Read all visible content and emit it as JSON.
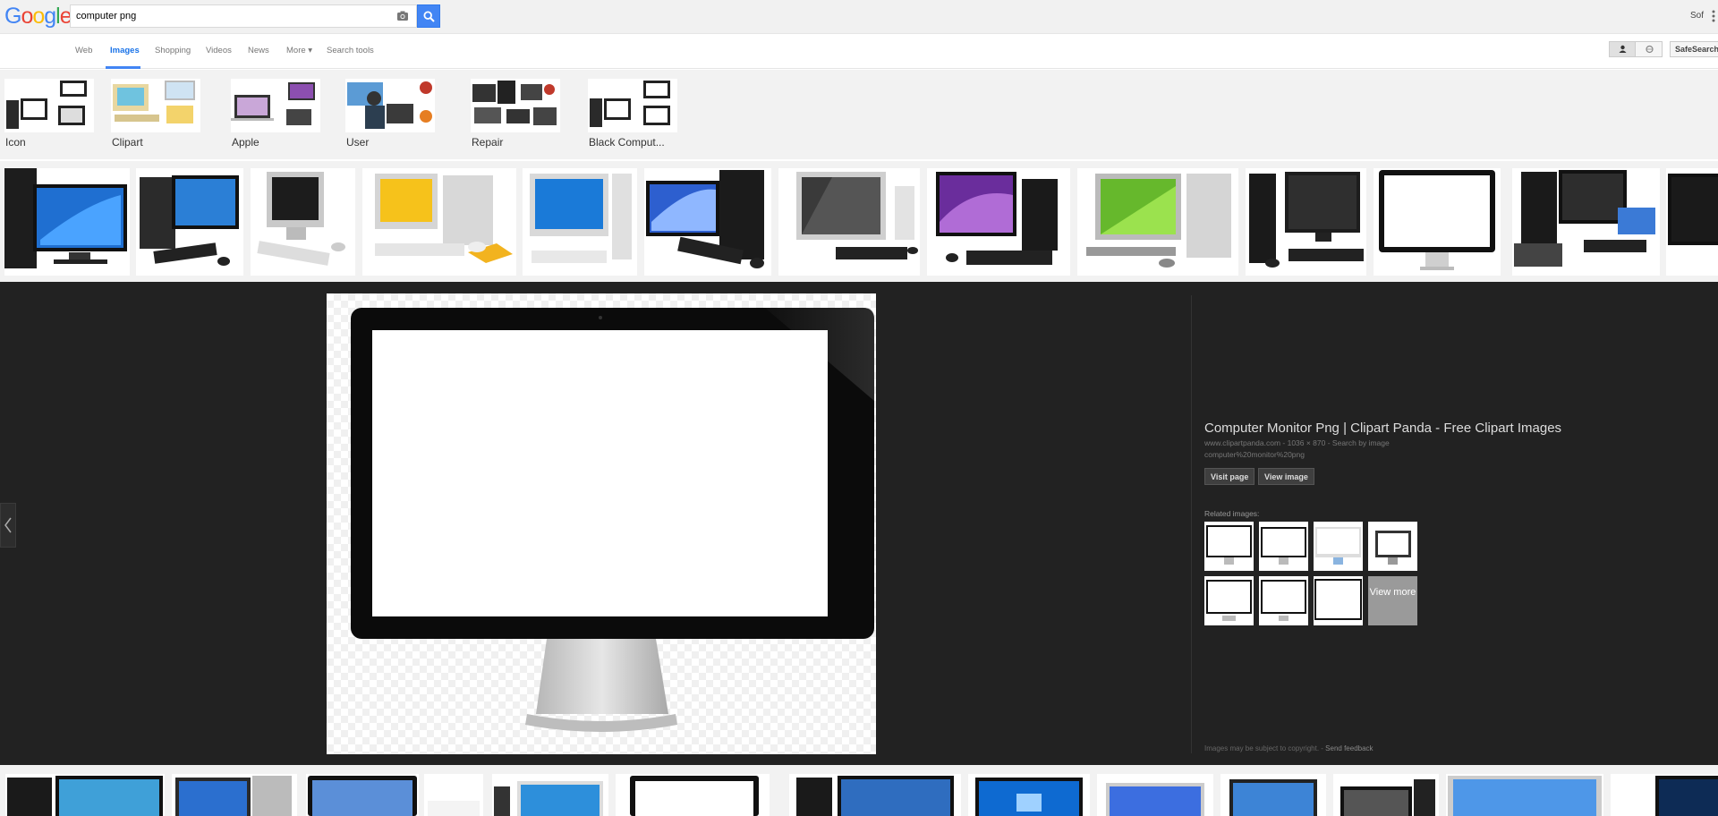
{
  "header": {
    "logo_letters": [
      {
        "ch": "G",
        "color": "#4285f4"
      },
      {
        "ch": "o",
        "color": "#ea4335"
      },
      {
        "ch": "o",
        "color": "#fbbc05"
      },
      {
        "ch": "g",
        "color": "#4285f4"
      },
      {
        "ch": "l",
        "color": "#34a853"
      },
      {
        "ch": "e",
        "color": "#ea4335"
      }
    ],
    "search_value": "computer png",
    "user_name": "Sof",
    "accent_color": "#4285f4"
  },
  "nav": {
    "tabs": [
      "Web",
      "Images",
      "Shopping",
      "Videos",
      "News",
      "More ▾",
      "Search tools"
    ],
    "active_tab": "Images",
    "safesearch_label": "SafeSearch"
  },
  "categories": [
    "Icon",
    "Clipart",
    "Apple",
    "User",
    "Repair",
    "Black Comput..."
  ],
  "preview": {
    "title": "Computer Monitor Png | Clipart Panda - Free Clipart Images",
    "meta": "www.clipartpanda.com - 1036 × 870 - Search by image",
    "filename": "computer%20monitor%20png",
    "visit_label": "Visit page",
    "view_label": "View image",
    "related_label": "Related images:",
    "view_more_label": "View more",
    "footer_text": "Images may be subject to copyright.",
    "feedback_label": "Send feedback"
  }
}
